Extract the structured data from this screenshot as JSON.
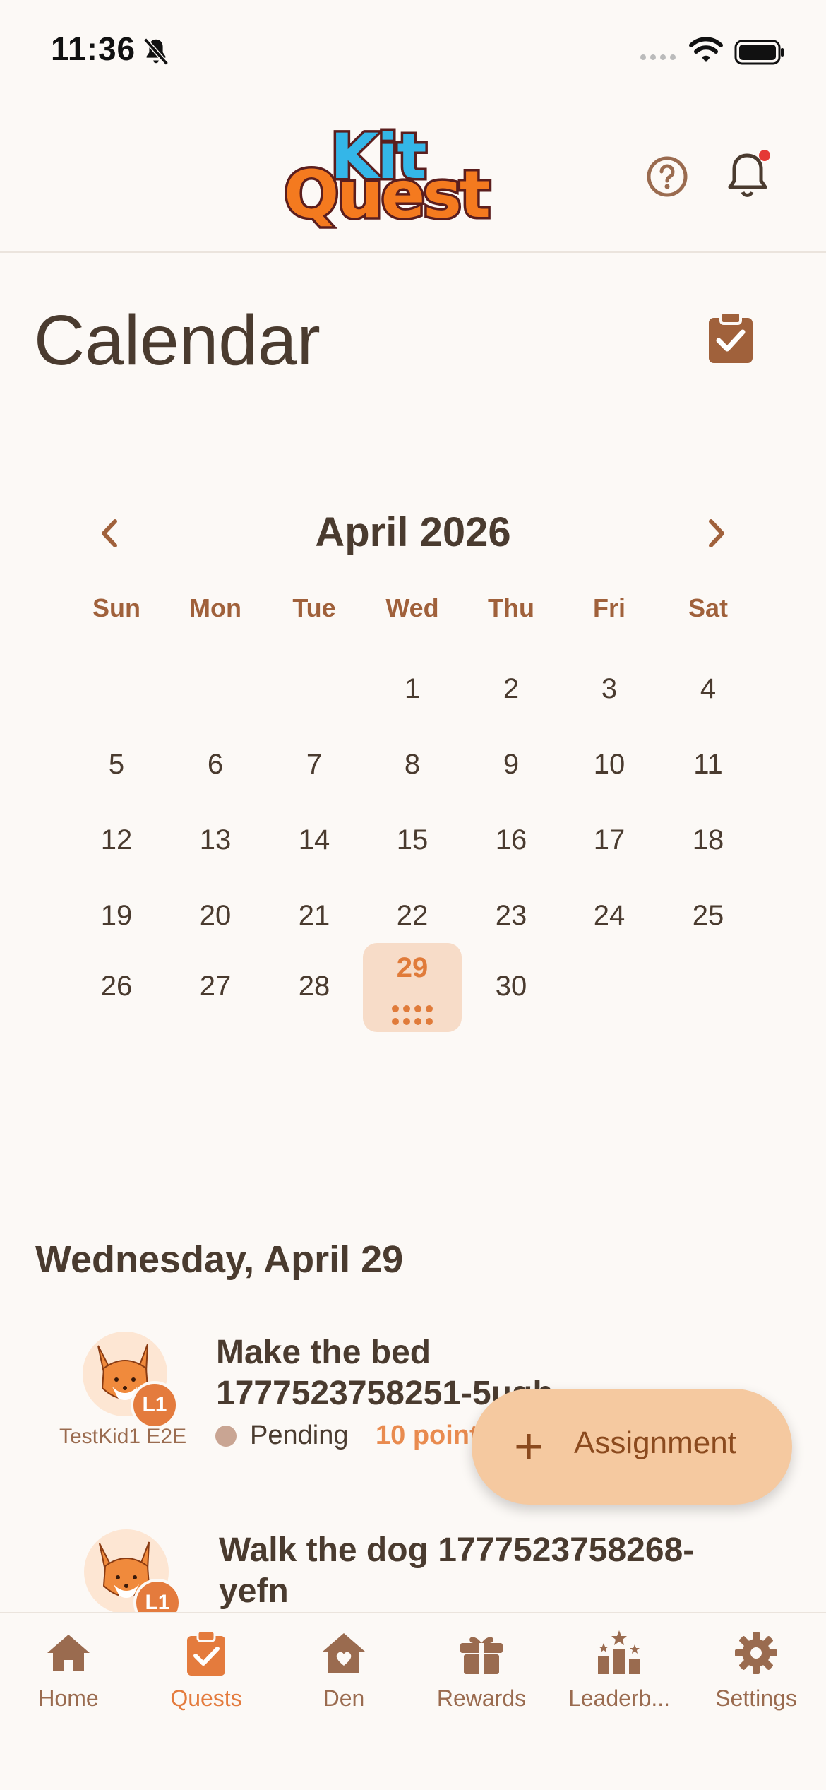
{
  "status_bar": {
    "time": "11:36"
  },
  "header": {
    "logo_text_top": "Kit",
    "logo_text_bottom": "Quest",
    "help_icon": "question-circle-icon",
    "notification_icon": "bell-icon",
    "notification_badge_color": "#e53935"
  },
  "page": {
    "title": "Calendar",
    "agenda_icon": "clipboard-check-icon"
  },
  "calendar": {
    "month_label": "April 2026",
    "weekdays": [
      "Sun",
      "Mon",
      "Tue",
      "Wed",
      "Thu",
      "Fri",
      "Sat"
    ],
    "weeks": [
      [
        "",
        "",
        "",
        "1",
        "2",
        "3",
        "4"
      ],
      [
        "5",
        "6",
        "7",
        "8",
        "9",
        "10",
        "11"
      ],
      [
        "12",
        "13",
        "14",
        "15",
        "16",
        "17",
        "18"
      ],
      [
        "19",
        "20",
        "21",
        "22",
        "23",
        "24",
        "25"
      ],
      [
        "26",
        "27",
        "28",
        "29",
        "30",
        "",
        ""
      ]
    ],
    "selected_day": "29"
  },
  "selected_date_label": "Wednesday, April 29",
  "tasks": [
    {
      "kid_name": "TestKid1 E2E",
      "level": "L1",
      "title_line1": "Make the bed",
      "title_line2": "1777523758251-5ugh",
      "status": "Pending",
      "points": "10 points"
    },
    {
      "kid_name": "",
      "level": "L1",
      "title_line1": "Walk the dog 1777523758268-",
      "title_line2": "yefn"
    }
  ],
  "fab": {
    "label": "Assignment",
    "icon": "plus-icon"
  },
  "nav": {
    "items": [
      {
        "label": "Home",
        "icon": "home-icon"
      },
      {
        "label": "Quests",
        "icon": "clipboard-check-icon",
        "active": true
      },
      {
        "label": "Den",
        "icon": "heart-house-icon"
      },
      {
        "label": "Rewards",
        "icon": "gift-icon"
      },
      {
        "label": "Leaderb...",
        "icon": "leaderboard-icon"
      },
      {
        "label": "Settings",
        "icon": "gear-icon"
      }
    ]
  },
  "colors": {
    "accent": "#e47b3d",
    "brown": "#9a6b4f",
    "text": "#4a3b2f",
    "background": "#fcf9f6",
    "fab": "#f5c9a0"
  }
}
